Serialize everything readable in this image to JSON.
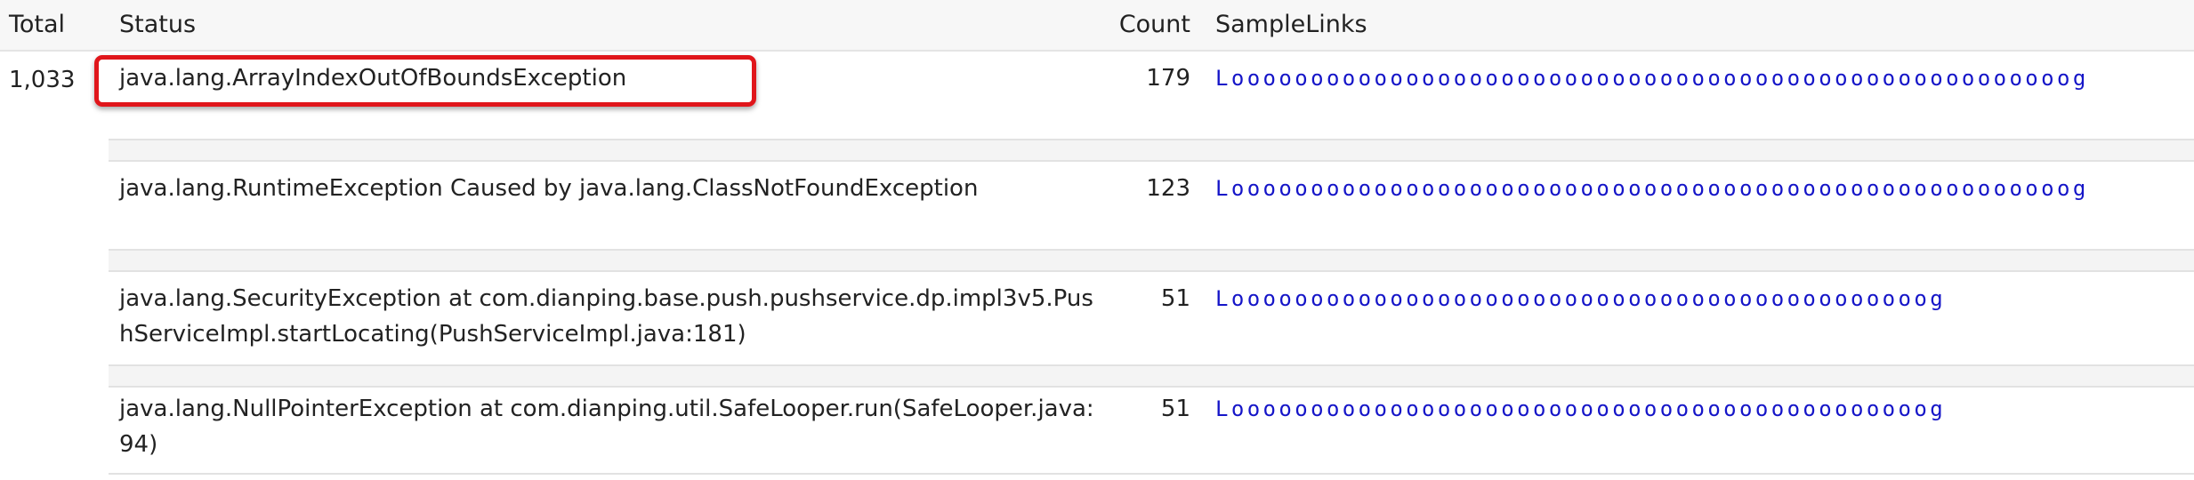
{
  "columns": {
    "total": "Total",
    "status": "Status",
    "count": "Count",
    "links": "SampleLinks"
  },
  "total_value": "1,033",
  "rows": [
    {
      "status": "java.lang.ArrayIndexOutOfBoundsException",
      "count": "179",
      "link": "Looooooooooooooooooooooooooooooooooooooooooooooooooooog",
      "highlighted": true
    },
    {
      "status": "java.lang.RuntimeException Caused by java.lang.ClassNotFoundException",
      "count": "123",
      "link": "Looooooooooooooooooooooooooooooooooooooooooooooooooooog",
      "highlighted": false
    },
    {
      "status": "java.lang.SecurityException at com.dianping.base.push.pushservice.dp.impl3v5.PushServiceImpl.startLocating(PushServiceImpl.java:181)",
      "count": "51",
      "link": "Loooooooooooooooooooooooooooooooooooooooooooog",
      "highlighted": false
    },
    {
      "status": "java.lang.NullPointerException at com.dianping.util.SafeLooper.run(SafeLooper.java:94)",
      "count": "51",
      "link": "Loooooooooooooooooooooooooooooooooooooooooooog",
      "highlighted": false
    }
  ],
  "colors": {
    "link": "#1515c8",
    "highlight_border": "#e0161b",
    "header_bg": "#f7f7f7",
    "separator_bg": "#f4f4f4"
  }
}
